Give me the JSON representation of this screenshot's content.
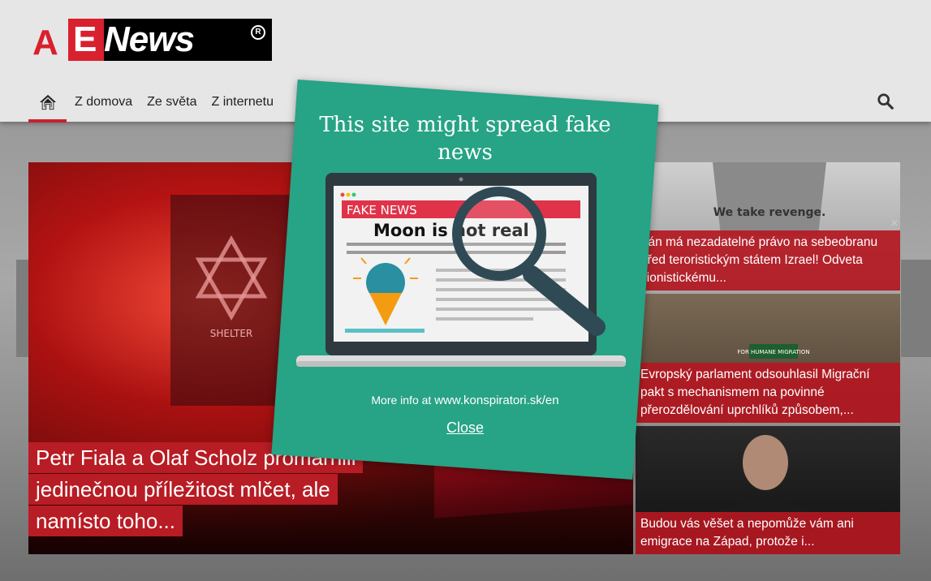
{
  "site": {
    "logo": {
      "a": "A",
      "e": "E",
      "news": "News",
      "reg": "R"
    }
  },
  "nav": {
    "items": [
      {
        "label": "Z domova"
      },
      {
        "label": "Ze světa"
      },
      {
        "label": "Z internetu"
      }
    ]
  },
  "articles": {
    "main": {
      "title": "Petr Fiala a Olaf Scholz promarnili jedinečnou příležitost mlčet, ale namísto toho..."
    },
    "side": [
      {
        "title": "Írán má nezadatelné právo na sebeobranu před teroristickým státem Izrael! Odveta sionistickému..."
      },
      {
        "title": "Evropský parlament odsouhlasil Migrační pakt s mechanismem na povinné přerozdělování uprchlíků způsobem,..."
      },
      {
        "title": "Budou vás věšet a nepomůže vám ani emigrace na Západ, protože i..."
      }
    ],
    "photo_text": {
      "sign": "We take revenge.",
      "badge": "FOR HUMANE MIGRATION",
      "shelter": "SHELTER"
    }
  },
  "modal": {
    "title": "This site might spread fake news",
    "illustration": {
      "banner": "FAKE NEWS",
      "headline": "Moon is not real"
    },
    "info_prefix": "More info at",
    "info_url": "www.konspiratori.sk/en",
    "close_label": "Close"
  },
  "colors": {
    "accent": "#c8202e",
    "modal_bg": "#27a385",
    "caption_bg": "#b81c24"
  },
  "icons": [
    "home-icon",
    "search-icon",
    "magnifier-icon"
  ]
}
